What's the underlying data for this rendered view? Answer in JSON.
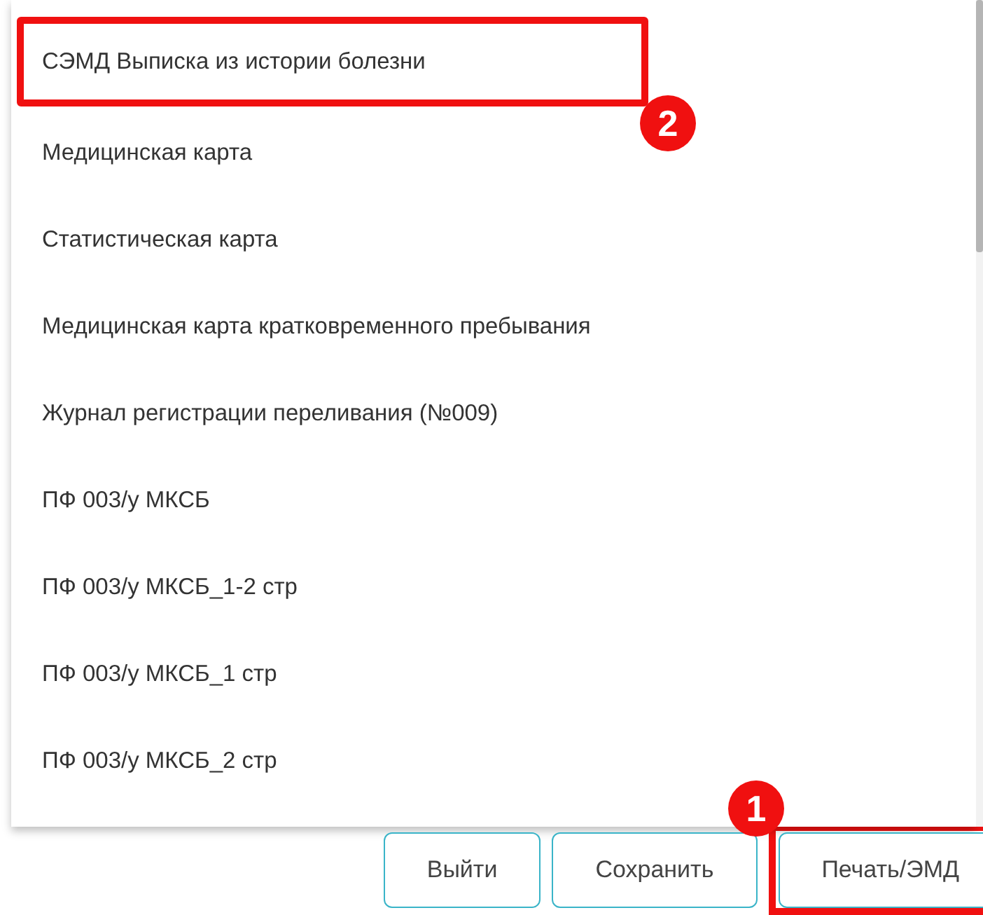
{
  "menu": {
    "items": [
      {
        "label": "СЭМД Выписка из истории болезни",
        "highlighted": true,
        "marker": "2"
      },
      {
        "label": "Медицинская карта",
        "highlighted": false
      },
      {
        "label": "Статистическая карта",
        "highlighted": false
      },
      {
        "label": "Медицинская карта кратковременного пребывания",
        "highlighted": false
      },
      {
        "label": "Журнал регистрации переливания (№009)",
        "highlighted": false
      },
      {
        "label": "ПФ 003/у МКСБ",
        "highlighted": false
      },
      {
        "label": "ПФ 003/у МКСБ_1-2 стр",
        "highlighted": false
      },
      {
        "label": "ПФ 003/у МКСБ_1 стр",
        "highlighted": false
      },
      {
        "label": "ПФ 003/у МКСБ_2 стр",
        "highlighted": false
      }
    ]
  },
  "buttons": [
    {
      "label": "Выйти",
      "highlighted": false
    },
    {
      "label": "Сохранить",
      "highlighted": false
    },
    {
      "label": "Печать/ЭМД",
      "highlighted": true,
      "marker": "1"
    }
  ]
}
